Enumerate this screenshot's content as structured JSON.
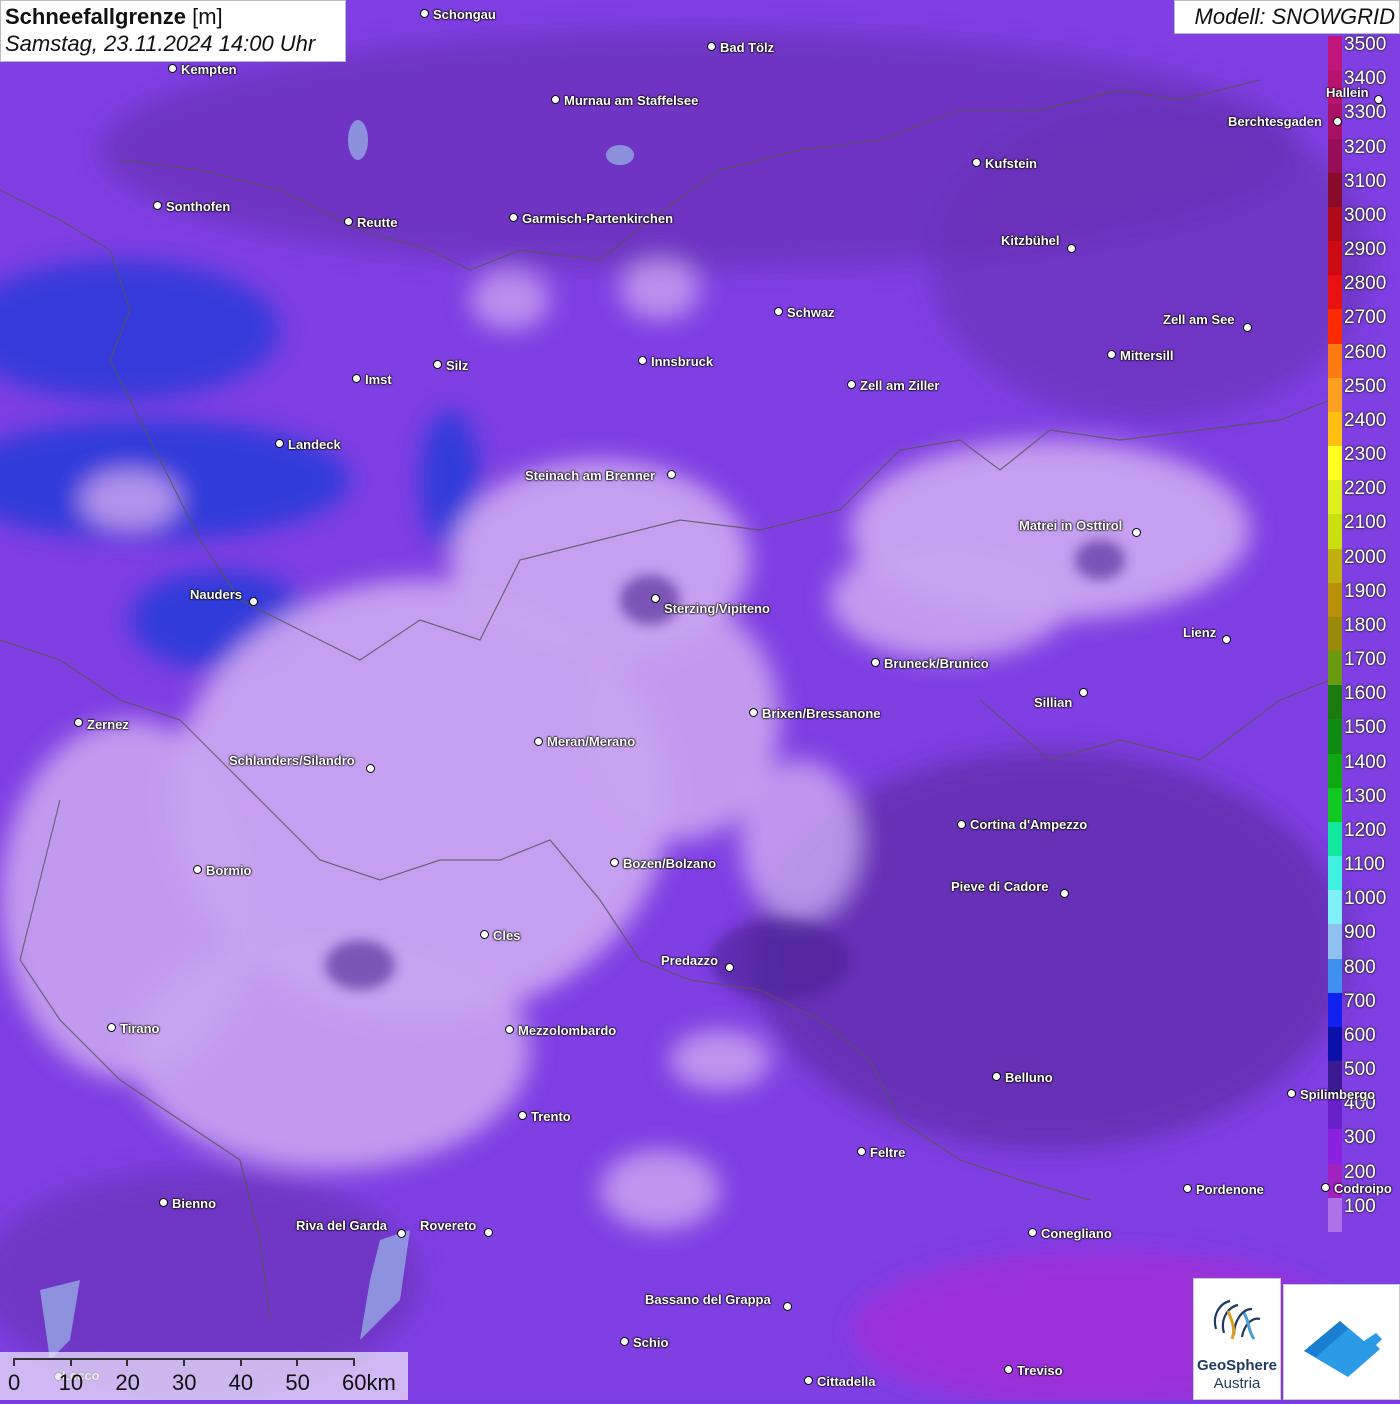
{
  "title": {
    "main": "Schneefallgrenze",
    "unit": "[m]",
    "datetime": "Samstag, 23.11.2024 14:00 Uhr"
  },
  "model": "Modell: SNOWGRID",
  "legend": {
    "labels": [
      "3500",
      "3400",
      "3300",
      "3200",
      "3100",
      "3000",
      "2900",
      "2800",
      "2700",
      "2600",
      "2500",
      "2400",
      "2300",
      "2200",
      "2100",
      "2000",
      "1900",
      "1800",
      "1700",
      "1600",
      "1500",
      "1400",
      "1300",
      "1200",
      "1100",
      "1000",
      "900",
      "800",
      "700",
      "600",
      "500",
      "400",
      "300",
      "200",
      "100"
    ],
    "colors": [
      "#c0157a",
      "#b8136f",
      "#a81064",
      "#980d58",
      "#8a0a2a",
      "#b00a1a",
      "#cc0a14",
      "#e81010",
      "#ff2a00",
      "#ff7a10",
      "#ffa020",
      "#ffc010",
      "#ffff20",
      "#ddf020",
      "#c8e010",
      "#c0b010",
      "#b8900a",
      "#9a8a0a",
      "#6a9a10",
      "#1a7a10",
      "#108a10",
      "#10a810",
      "#10c820",
      "#10e8a0",
      "#40f0e0",
      "#80f0f8",
      "#90c0f0",
      "#4090f0",
      "#1020f0",
      "#0a10a8",
      "#3a1a90",
      "#6a20c8",
      "#8a20e0",
      "#a020c0",
      "#b070e8"
    ]
  },
  "cities": [
    {
      "name": "Schongau"
    },
    {
      "name": "Bad Tölz"
    },
    {
      "name": "Kempten"
    },
    {
      "name": "Murnau am Staffelsee"
    },
    {
      "name": "Hallein"
    },
    {
      "name": "Berchtesgaden"
    },
    {
      "name": "Kufstein"
    },
    {
      "name": "Sonthofen"
    },
    {
      "name": "Reutte"
    },
    {
      "name": "Garmisch-Partenkirchen"
    },
    {
      "name": "Kitzbühel"
    },
    {
      "name": "Schwaz"
    },
    {
      "name": "Zell am See"
    },
    {
      "name": "Mittersill"
    },
    {
      "name": "Imst"
    },
    {
      "name": "Silz"
    },
    {
      "name": "Innsbruck"
    },
    {
      "name": "Zell am Ziller"
    },
    {
      "name": "Landeck"
    },
    {
      "name": "Steinach am Brenner"
    },
    {
      "name": "Matrei in Osttirol"
    },
    {
      "name": "Nauders"
    },
    {
      "name": "Sterzing/Vipiteno"
    },
    {
      "name": "Lienz"
    },
    {
      "name": "Bruneck/Brunico"
    },
    {
      "name": "Sillian"
    },
    {
      "name": "Zernez"
    },
    {
      "name": "Brixen/Bressanone"
    },
    {
      "name": "Meran/Merano"
    },
    {
      "name": "Schlanders/Silandro"
    },
    {
      "name": "Cortina d'Ampezzo"
    },
    {
      "name": "Bozen/Bolzano"
    },
    {
      "name": "Bormio"
    },
    {
      "name": "Pieve di Cadore"
    },
    {
      "name": "Cles"
    },
    {
      "name": "Predazzo"
    },
    {
      "name": "Tirano"
    },
    {
      "name": "Mezzolombardo"
    },
    {
      "name": "Belluno"
    },
    {
      "name": "Spilimbergo"
    },
    {
      "name": "Trento"
    },
    {
      "name": "Feltre"
    },
    {
      "name": "Pordenone"
    },
    {
      "name": "Codroipo"
    },
    {
      "name": "Bienno"
    },
    {
      "name": "Riva del Garda"
    },
    {
      "name": "Rovereto"
    },
    {
      "name": "Conegliano"
    },
    {
      "name": "Bassano del Grappa"
    },
    {
      "name": "Schio"
    },
    {
      "name": "Treviso"
    },
    {
      "name": "Cittadella"
    },
    {
      "name": "Lecco"
    }
  ],
  "scale": {
    "labels": [
      "0",
      "10",
      "20",
      "30",
      "40",
      "50",
      "60km"
    ]
  },
  "logos": {
    "geosphere_line1": "GeoSphere",
    "geosphere_line2": "Austria"
  }
}
